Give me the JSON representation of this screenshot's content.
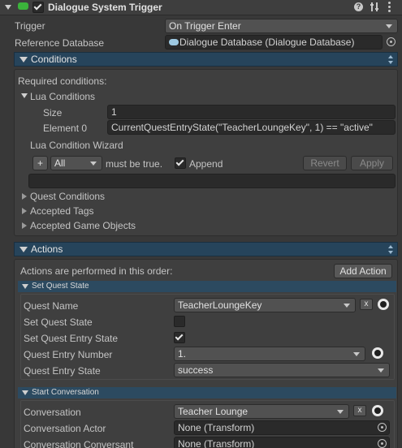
{
  "header": {
    "title": "Dialogue System Trigger",
    "enabled": true
  },
  "trigger": {
    "label": "Trigger",
    "value": "On Trigger Enter"
  },
  "reference_database": {
    "label": "Reference Database",
    "value": "Dialogue Database (Dialogue Database)"
  },
  "conditions": {
    "title": "Conditions",
    "required_label": "Required conditions:",
    "lua_conditions": {
      "label": "Lua Conditions",
      "size_label": "Size",
      "size_value": "1",
      "element_label": "Element 0",
      "element_value": "CurrentQuestEntryState(\"TeacherLoungeKey\", 1) == \"active\""
    },
    "wizard": {
      "label": "Lua Condition Wizard",
      "plus_label": "+",
      "mode_value": "All",
      "must_be_true": "must be true.",
      "append_label": "Append",
      "append_checked": true,
      "revert_label": "Revert",
      "apply_label": "Apply"
    },
    "foldouts": [
      "Quest Conditions",
      "Accepted Tags",
      "Accepted Game Objects"
    ]
  },
  "actions": {
    "title": "Actions",
    "order_text": "Actions are performed in this order:",
    "add_action_label": "Add Action",
    "set_quest_state": {
      "title": "Set Quest State",
      "quest_name_label": "Quest Name",
      "quest_name_value": "TeacherLoungeKey",
      "set_quest_state_label": "Set Quest State",
      "set_quest_state_checked": false,
      "set_entry_state_label": "Set Quest Entry State",
      "set_entry_state_checked": true,
      "entry_number_label": "Quest Entry Number",
      "entry_number_value": "1.",
      "entry_state_label": "Quest Entry State",
      "entry_state_value": "success"
    },
    "start_conversation": {
      "title": "Start Conversation",
      "conversation_label": "Conversation",
      "conversation_value": "Teacher Lounge",
      "actor_label": "Conversation Actor",
      "actor_value": "None (Transform)",
      "conversant_label": "Conversation Conversant",
      "conversant_value": "None (Transform)"
    },
    "x_label": "x"
  },
  "colors": {
    "background": "#383838",
    "section_header": "#26445b",
    "field": "#2a2a2a"
  }
}
